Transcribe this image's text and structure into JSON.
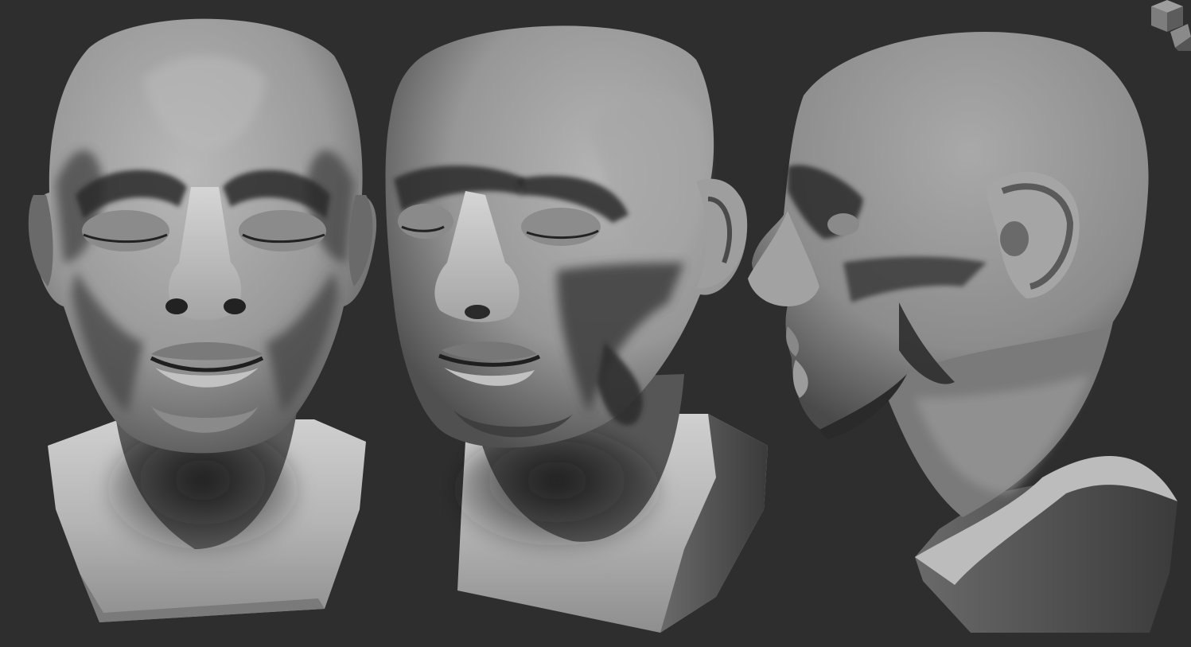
{
  "viewport": {
    "background_color": "#2e2e2e",
    "mesh_color": "#a9a9a9",
    "views": [
      {
        "name": "front-view",
        "angle": "front"
      },
      {
        "name": "three-quarter-view",
        "angle": "three-quarter"
      },
      {
        "name": "profile-view",
        "angle": "side"
      }
    ]
  },
  "navigation_gizmo": {
    "icon": "nav-cube-icon"
  }
}
